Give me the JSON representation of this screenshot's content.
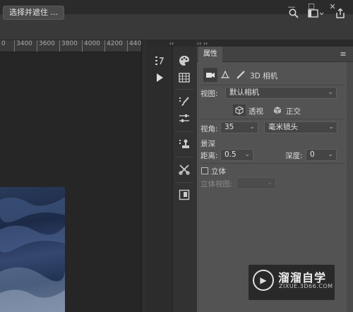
{
  "window": {
    "minimize_icon": "minimize-icon",
    "maximize_icon": "maximize-icon",
    "close_icon": "close-icon"
  },
  "options_bar": {
    "select_mask_label": "选择并遮住 ...",
    "icons": [
      "search-icon",
      "workspace-icon",
      "share-icon"
    ]
  },
  "ruler": {
    "ticks": [
      "0",
      "3400",
      "3600",
      "3800",
      "4000",
      "4200",
      "440"
    ]
  },
  "collapse": {
    "left_arrows": "‹‹",
    "right_arrows": "‹‹ ››"
  },
  "toolbar": {
    "icons": [
      "history-icon",
      "play-icon",
      "color-icon",
      "swatches-icon",
      "brush-settings-icon",
      "brush-icon",
      "adjustments-icon",
      "clone-source-icon",
      "tool-presets-icon",
      "layers-icon"
    ]
  },
  "properties": {
    "tab": "属性",
    "mode_label": "3D 相机",
    "view_label": "视图:",
    "view_value": "默认相机",
    "perspective_label": "透视",
    "ortho_label": "正交",
    "fov_label": "视角:",
    "fov_value": "35",
    "lens_value": "毫米镜头",
    "dof_label": "景深",
    "distance_label": "距离:",
    "distance_value": "0.5",
    "depth_label": "深度:",
    "depth_value": "0",
    "stereo_label": "立体",
    "stereo_view_label": "立体视图:",
    "stereo_view_value": ""
  },
  "watermark": {
    "title": "溜溜自学",
    "url": "ZIXUE.3D66.COM"
  },
  "colors": {
    "panel_bg": "#535353",
    "toolbar_bg": "#2c2c2c",
    "doc_bg": "#282828"
  }
}
